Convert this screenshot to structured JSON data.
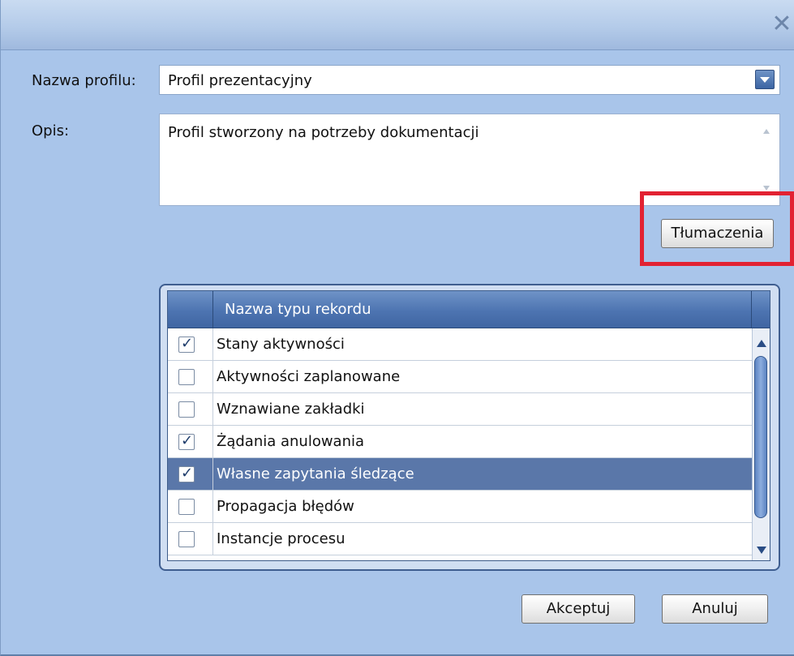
{
  "dialog": {
    "close_glyph": "✕"
  },
  "form": {
    "profile_name_label": "Nazwa profilu:",
    "profile_name_value": "Profil prezentacyjny",
    "description_label": "Opis:",
    "description_value": "Profil stworzony na potrzeby dokumentacji",
    "translations_button": "Tłumaczenia"
  },
  "grid": {
    "column_header": "Nazwa typu rekordu",
    "rows": [
      {
        "label": "Stany aktywności",
        "checked": true,
        "selected": false
      },
      {
        "label": "Aktywności zaplanowane",
        "checked": false,
        "selected": false
      },
      {
        "label": "Wznawiane zakładki",
        "checked": false,
        "selected": false
      },
      {
        "label": "Żądania anulowania",
        "checked": true,
        "selected": false
      },
      {
        "label": "Własne zapytania śledzące",
        "checked": true,
        "selected": true
      },
      {
        "label": "Propagacja błędów",
        "checked": false,
        "selected": false
      },
      {
        "label": "Instancje procesu",
        "checked": false,
        "selected": false
      }
    ]
  },
  "footer": {
    "accept_button": "Akceptuj",
    "cancel_button": "Anuluj"
  },
  "colors": {
    "dialog_background": "#a9c5ea",
    "header_blue": "#4d74b1",
    "selected_row": "#5a77a9",
    "highlight_red": "#e22232"
  }
}
